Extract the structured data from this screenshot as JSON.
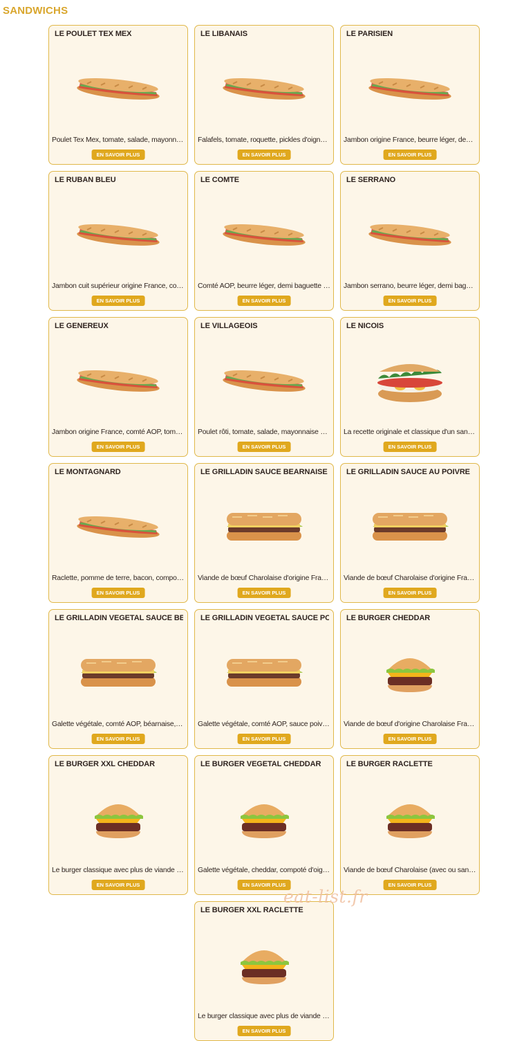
{
  "section": {
    "title": "SANDWICHS"
  },
  "watermark": "eat-list.fr",
  "items": [
    {
      "title": "LE POULET TEX MEX",
      "description": "Poulet Tex Mex, tomate, salade, mayonnaise…",
      "button": "EN SAVOIR PLUS",
      "icon": "baguette-sandwich-icon"
    },
    {
      "title": "LE LIBANAIS",
      "description": "Falafels, tomate, roquette, pickles d'oignons…",
      "button": "EN SAVOIR PLUS",
      "icon": "baguette-sandwich-icon"
    },
    {
      "title": "LE PARISIEN",
      "description": "Jambon origine France, beurre léger, demi b…",
      "button": "EN SAVOIR PLUS",
      "icon": "baguette-sandwich-icon"
    },
    {
      "title": "LE RUBAN BLEU",
      "description": "Jambon cuit supérieur origine France, comt…",
      "button": "EN SAVOIR PLUS",
      "icon": "baguette-sandwich-icon"
    },
    {
      "title": "LE COMTE",
      "description": "Comté AOP, beurre léger, demi baguette rus…",
      "button": "EN SAVOIR PLUS",
      "icon": "baguette-sandwich-icon"
    },
    {
      "title": "LE SERRANO",
      "description": "Jambon serrano, beurre léger, demi baguett…",
      "button": "EN SAVOIR PLUS",
      "icon": "baguette-sandwich-icon"
    },
    {
      "title": "LE GENEREUX",
      "description": "Jambon origine France, comté AOP, tomate,…",
      "button": "EN SAVOIR PLUS",
      "icon": "baguette-sandwich-icon"
    },
    {
      "title": "LE VILLAGEOIS",
      "description": "Poulet rôti, tomate, salade, mayonnaise allé…",
      "button": "EN SAVOIR PLUS",
      "icon": "baguette-sandwich-icon"
    },
    {
      "title": "LE NICOIS",
      "description": "La recette originale et classique d'un sandw…",
      "button": "EN SAVOIR PLUS",
      "icon": "round-sandwich-icon"
    },
    {
      "title": "LE MONTAGNARD",
      "description": "Raclette, pomme de terre, bacon, compotée…",
      "button": "EN SAVOIR PLUS",
      "icon": "baguette-sandwich-icon"
    },
    {
      "title": "LE GRILLADIN SAUCE BEARNAISE",
      "description": "Viande de bœuf Charolaise d'origine Françai…",
      "button": "EN SAVOIR PLUS",
      "icon": "sub-sandwich-icon"
    },
    {
      "title": "LE GRILLADIN SAUCE AU POIVRE",
      "description": "Viande de bœuf Charolaise d'origine Françai…",
      "button": "EN SAVOIR PLUS",
      "icon": "sub-sandwich-icon"
    },
    {
      "title": "LE GRILLADIN VEGETAL SAUCE BEAR",
      "description": "Galette végétale, comté AOP, béarnaise, sal…",
      "button": "EN SAVOIR PLUS",
      "icon": "sub-sandwich-icon"
    },
    {
      "title": "LE GRILLADIN VEGETAL SAUCE POIVRE",
      "description": "Galette végétale, comté AOP, sauce poivre, …",
      "button": "EN SAVOIR PLUS",
      "icon": "sub-sandwich-icon"
    },
    {
      "title": "LE BURGER CHEDDAR",
      "description": "Viande de bœuf d'origine Charolaise Françai…",
      "button": "EN SAVOIR PLUS",
      "icon": "burger-icon"
    },
    {
      "title": "LE BURGER XXL CHEDDAR",
      "description": "Le burger classique avec plus de viande de …",
      "button": "EN SAVOIR PLUS",
      "icon": "burger-icon"
    },
    {
      "title": "LE BURGER VEGETAL CHEDDAR",
      "description": "Galette végétale, cheddar, compoté d'oigno…",
      "button": "EN SAVOIR PLUS",
      "icon": "burger-icon"
    },
    {
      "title": "LE BURGER RACLETTE",
      "description": "Viande de bœuf Charolaise (avec ou sans b…",
      "button": "EN SAVOIR PLUS",
      "icon": "burger-icon"
    },
    {
      "title": "LE BURGER XXL RACLETTE",
      "description": "Le burger classique avec plus de viande de …",
      "button": "EN SAVOIR PLUS",
      "icon": "burger-icon"
    }
  ]
}
